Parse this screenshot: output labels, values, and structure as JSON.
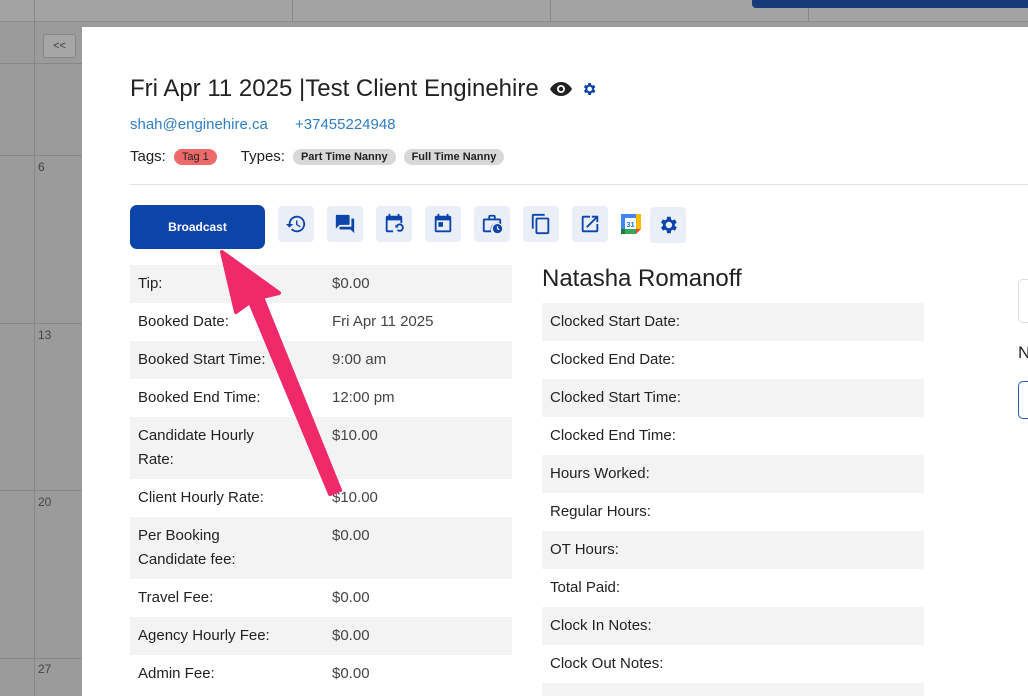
{
  "calendar": {
    "prev_label": "<<",
    "day_numbers": [
      "6",
      "13",
      "20",
      "27"
    ]
  },
  "header": {
    "title_date": "Fri Apr 11 2025",
    "title_separator": "|",
    "title_client": "Test Client Enginehire",
    "email": "shah@enginehire.ca",
    "phone": "+37455224948"
  },
  "tags": {
    "tags_label": "Tags:",
    "tags": [
      "Tag 1"
    ],
    "types_label": "Types:",
    "types": [
      "Part Time Nanny",
      "Full Time Nanny"
    ]
  },
  "toolbar": {
    "broadcast_label": "Broadcast",
    "icons": [
      "history-icon",
      "chat-icon",
      "calendar-refresh-icon",
      "calendar-icon",
      "briefcase-clock-icon",
      "copy-icon",
      "external-link-icon",
      "google-calendar-icon",
      "gear-icon"
    ],
    "gcal_day": "31"
  },
  "details": [
    {
      "label": "Tip:",
      "value": "$0.00"
    },
    {
      "label": "Booked Date:",
      "value": "Fri Apr 11 2025"
    },
    {
      "label": "Booked Start Time:",
      "value": "9:00 am"
    },
    {
      "label": "Booked End Time:",
      "value": "12:00 pm"
    },
    {
      "label": "Candidate Hourly Rate:",
      "value": "$10.00"
    },
    {
      "label": "Client Hourly Rate:",
      "value": "$10.00"
    },
    {
      "label": "Per Booking Candidate fee:",
      "value": "$0.00"
    },
    {
      "label": "Travel Fee:",
      "value": "$0.00"
    },
    {
      "label": "Agency Hourly Fee:",
      "value": "$0.00"
    },
    {
      "label": "Admin Fee:",
      "value": "$0.00"
    }
  ],
  "candidate": {
    "name": "Natasha Romanoff",
    "fields": [
      "Clocked Start Date:",
      "Clocked End Date:",
      "Clocked Start Time:",
      "Clocked End Time:",
      "Hours Worked:",
      "Regular Hours:",
      "OT Hours:",
      "Total Paid:",
      "Clock In Notes:",
      "Clock Out Notes:"
    ]
  },
  "side": {
    "partial_label": "N"
  },
  "colors": {
    "primary": "#0c44aa",
    "link": "#2f7dc7",
    "tag_red": "#ee6a6a",
    "arrow": "#f0296b"
  }
}
